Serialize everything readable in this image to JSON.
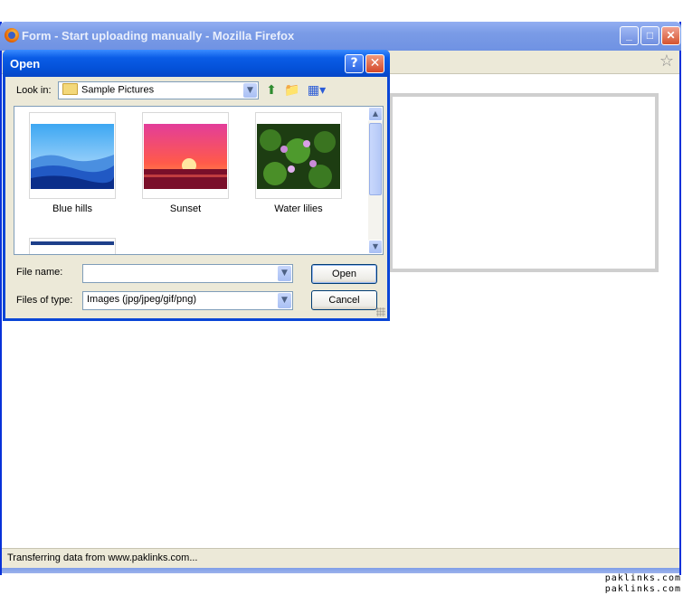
{
  "window": {
    "title": "Form - Start uploading manually - Mozilla Firefox",
    "status": "Transferring data from www.paklinks.com...",
    "minimize": "_",
    "maximize": "□",
    "close": "✕"
  },
  "dialog": {
    "title": "Open",
    "help": "?",
    "close": "✕",
    "look_in_label": "Look in:",
    "look_in_value": "Sample Pictures",
    "files": [
      {
        "name": "Blue hills"
      },
      {
        "name": "Sunset"
      },
      {
        "name": "Water lilies"
      }
    ],
    "file_name_label": "File name:",
    "file_name_value": "",
    "files_of_type_label": "Files of type:",
    "files_of_type_value": "Images (jpg/jpeg/gif/png)",
    "open_button": "Open",
    "cancel_button": "Cancel"
  },
  "watermark": [
    "paklinks.com",
    "paklinks.com"
  ],
  "icons": {
    "star": "star-icon",
    "up": "up-folder-icon",
    "new_folder": "new-folder-icon",
    "views": "views-menu-icon"
  }
}
